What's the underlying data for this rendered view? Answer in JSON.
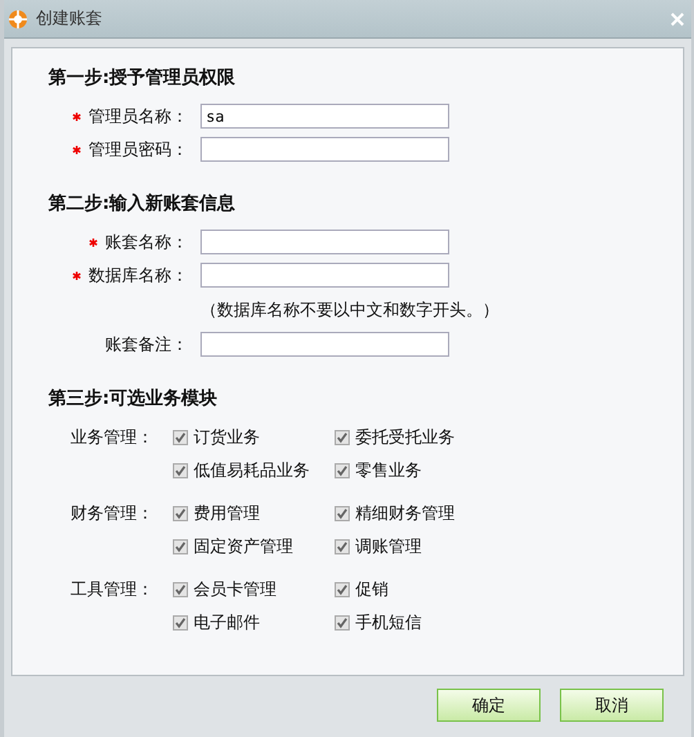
{
  "window": {
    "title": "创建账套"
  },
  "steps": [
    {
      "heading": "第一步:授予管理员权限",
      "items": [
        {
          "kind": "field",
          "label": "管理员名称：",
          "required": true,
          "value": "sa"
        },
        {
          "kind": "field",
          "label": "管理员密码：",
          "required": true,
          "value": ""
        }
      ]
    },
    {
      "heading": "第二步:输入新账套信息",
      "items": [
        {
          "kind": "field",
          "label": "账套名称：",
          "required": true,
          "value": ""
        },
        {
          "kind": "field",
          "label": "数据库名称：",
          "required": true,
          "value": ""
        },
        {
          "kind": "note",
          "text": "（数据库名称不要以中文和数字开头。）"
        },
        {
          "kind": "field",
          "label": "账套备注：",
          "required": false,
          "value": ""
        }
      ]
    },
    {
      "heading": "第三步:可选业务模块",
      "groups": [
        {
          "label": "业务管理：",
          "options": [
            {
              "label": "订货业务",
              "checked": true,
              "disabled": true
            },
            {
              "label": "委托受托业务",
              "checked": true,
              "disabled": true
            },
            {
              "label": "低值易耗品业务",
              "checked": true,
              "disabled": true
            },
            {
              "label": "零售业务",
              "checked": true,
              "disabled": true
            }
          ]
        },
        {
          "label": "财务管理：",
          "options": [
            {
              "label": "费用管理",
              "checked": true,
              "disabled": true
            },
            {
              "label": "精细财务管理",
              "checked": true,
              "disabled": true
            },
            {
              "label": "固定资产管理",
              "checked": true,
              "disabled": true
            },
            {
              "label": "调账管理",
              "checked": true,
              "disabled": true
            }
          ]
        },
        {
          "label": "工具管理：",
          "options": [
            {
              "label": "会员卡管理",
              "checked": true,
              "disabled": true
            },
            {
              "label": "促销",
              "checked": true,
              "disabled": true
            },
            {
              "label": "电子邮件",
              "checked": true,
              "disabled": true
            },
            {
              "label": "手机短信",
              "checked": true,
              "disabled": true
            }
          ]
        }
      ]
    }
  ],
  "buttons": [
    {
      "label": "确定"
    },
    {
      "label": "取消"
    }
  ]
}
